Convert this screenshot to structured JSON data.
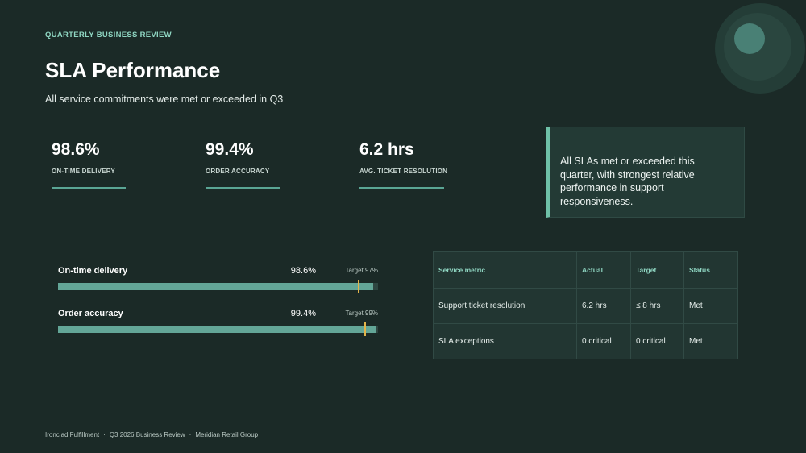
{
  "eyebrow": "QUARTERLY BUSINESS REVIEW",
  "title": "SLA Performance",
  "subtitle": "All service commitments were met or exceeded in Q3",
  "kpis": [
    {
      "value": "98.6%",
      "label": "ON-TIME DELIVERY"
    },
    {
      "value": "99.4%",
      "label": "ORDER ACCURACY"
    },
    {
      "value": "6.2 hrs",
      "label": "AVG. TICKET RESOLUTION"
    }
  ],
  "callout": "All SLAs met or exceeded this quarter, with strongest relative performance in support responsiveness.",
  "bars": [
    {
      "name": "On-time delivery",
      "value_label": "98.6%",
      "target_label": "Target 97%",
      "value": 98.6,
      "target": 97,
      "scale_min": 0,
      "scale_max": 100
    },
    {
      "name": "Order accuracy",
      "value_label": "99.4%",
      "target_label": "Target 99%",
      "value": 99.4,
      "target": 99,
      "scale_min": 0,
      "scale_max": 100
    }
  ],
  "table": {
    "headers": [
      "Service metric",
      "Actual",
      "Target",
      "Status"
    ],
    "rows": [
      [
        "Support ticket resolution",
        "6.2 hrs",
        "≤ 8 hrs",
        "Met"
      ],
      [
        "SLA exceptions",
        "0 critical",
        "0 critical",
        "Met"
      ]
    ]
  },
  "footer": {
    "company": "Ironclad Fulfillment",
    "review": "Q3 2026 Business Review",
    "client": "Meridian Retail Group",
    "separator": "·"
  },
  "colors": {
    "background": "#1b2a27",
    "accent": "#8fd6c2",
    "bar_fill": "#63a697",
    "target_marker": "#e2b44a"
  }
}
